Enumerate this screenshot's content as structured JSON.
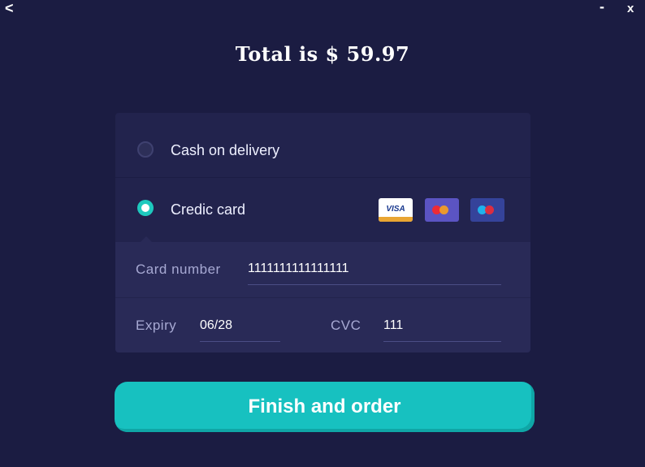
{
  "window": {
    "back_label": "<",
    "minimize_label": "-",
    "close_label": "x"
  },
  "total": {
    "text": "Total is $ 59.97"
  },
  "payment": {
    "options": [
      {
        "label": "Cash on delivery",
        "selected": false
      },
      {
        "label": "Credic card",
        "selected": true
      }
    ],
    "card_logos": [
      {
        "name": "visa",
        "text": "VISA"
      },
      {
        "name": "mastercard"
      },
      {
        "name": "maestro"
      }
    ],
    "fields": {
      "card_number_label": "Card number",
      "card_number_value": "1111111111111111",
      "expiry_label": "Expiry",
      "expiry_value": "06/28",
      "cvc_label": "CVC",
      "cvc_value": "111"
    }
  },
  "finish_button": {
    "label": "Finish and order"
  },
  "colors": {
    "background": "#1b1c42",
    "panel": "#22234d",
    "accent": "#17c1c0"
  }
}
